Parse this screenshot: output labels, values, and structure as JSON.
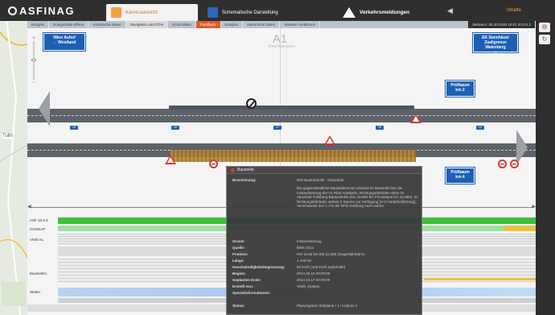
{
  "header": {
    "logo": "ASFINAG",
    "tabs": [
      {
        "label": "Kameraansicht",
        "icon": "camera-icon"
      },
      {
        "label": "Schematische Darstellung",
        "icon": "diagram-icon"
      },
      {
        "label": "Verkehrsmeldungen",
        "icon": "warning-icon"
      }
    ],
    "user": "Inhalte"
  },
  "subtabs": [
    {
      "label": "Ereignis"
    },
    {
      "label": "Ereignisliste öffnen"
    },
    {
      "label": "Historische Daten"
    },
    {
      "label": "Navigation und POIs"
    },
    {
      "label": "Umschalten"
    },
    {
      "label": "Feedback"
    },
    {
      "label": "Ereignis"
    },
    {
      "label": "Historische Daten"
    },
    {
      "label": "Weitere Funktionen"
    },
    {
      "label": "Zeitraum: 30.10.2015 10:51 20.0.0 2"
    }
  ],
  "map_label": "Tulln",
  "road": {
    "name": "A1",
    "subtitle": "West Autobahn"
  },
  "signs": {
    "top_left": "Wien Auhof\n← Westland",
    "top_right": "EK Steinhäusl\nZaaligrenze Walenberg\n→",
    "pb_top": "Prüfbaum\nkm 2",
    "pb_bottom": "Prüfbaum\nkm 4"
  },
  "km_badges_top": [
    "15",
    "16",
    "17",
    "18",
    "19"
  ],
  "km_badges_bottom": [
    "15",
    "16",
    "17",
    "18",
    "19"
  ],
  "round_signs": [
    "80",
    "80",
    "80"
  ],
  "bands": [
    {
      "label": "ASF 16.2.0"
    },
    {
      "label": "GOSNAP"
    },
    {
      "label": "VMIS KL"
    },
    {
      "label": "Baustellen"
    },
    {
      "label": "Wetter"
    }
  ],
  "popup": {
    "title": "Baustelle",
    "rows": [
      {
        "k": "Bezeichnung:",
        "v": "RIO Baukontrolle - Oeswinde"
      },
      {
        "k": "",
        "v": "Die gegenständliche Baustellenzone umfasst im Wesentlichen die Instandsetzung der A1 Pfad Autobahn, Richtungsfahrbahn Wien im Abschnitt Tullnberg-Baukontrolle (km 15.850 bis Prinzatspot km 22.350). Im Richtungsfahrbahn stehen 2 Spuren zur Verfügung (2+0 Verkehrsführung). Verschwenkt des 1. FS der RFB Salzburg nach außen."
      },
      {
        "k": "Grund:",
        "v": "Instandsetzung"
      },
      {
        "k": "Quelle:",
        "v": "BMS 2013"
      },
      {
        "k": "Position:",
        "v": "KM 15.55 bis KM 22.355 (Gegenfahrbahn)"
      },
      {
        "k": "Länge:",
        "v": "2.400 km"
      },
      {
        "k": "Geschwindigkeitsbegrenzung:",
        "v": "80 km/h (100 km/h außerhalb)"
      },
      {
        "k": "Beginn:",
        "v": "2014.05.15 00:00:00"
      },
      {
        "k": "Geplantes Ende:",
        "v": "2014.10.17 00:00:00"
      },
      {
        "k": "Erstellt von:",
        "v": "VMIS_System"
      },
      {
        "k": "Spezialinformationen:",
        "v": ""
      },
      {
        "k": "Status:",
        "v": "Planungskorr Zeitplane / 1 / Kaduze 2"
      }
    ]
  },
  "colors": {
    "accent": "#e05a2a",
    "header": "#2f2f2f",
    "sign_blue": "#1d5fb4",
    "road": "#5e6369",
    "green": "#3fbf3f"
  }
}
